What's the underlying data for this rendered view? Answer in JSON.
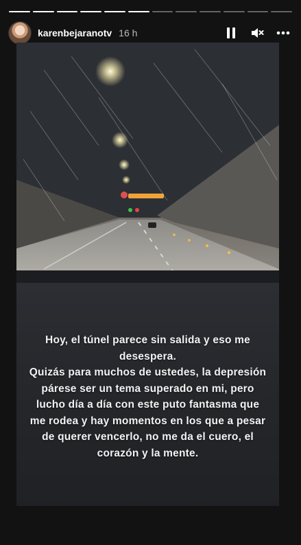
{
  "story": {
    "username": "karenbejaranotv",
    "time_ago": "16 h",
    "progress": {
      "segments_total": 12,
      "segments_done": 6
    },
    "icons": {
      "pause": "pause-icon",
      "mute": "speaker-muted-icon",
      "more": "more-horizontal-icon"
    },
    "caption": "Hoy, el túnel parece sin salida y eso me desespera.\nQuizás para muchos de ustedes, la depresión párese ser un tema superado en mi, pero lucho día a día con este puto fantasma que me rodea y hay momentos en los que a pesar de querer vencerlo, no me da el cuero, el corazón y la mente."
  }
}
